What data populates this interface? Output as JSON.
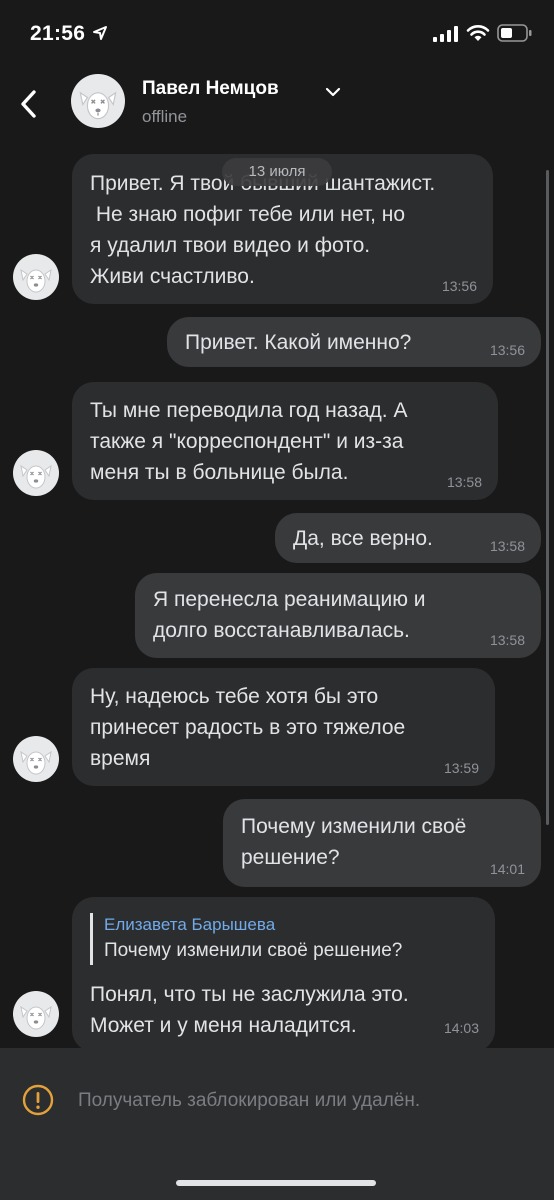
{
  "status": {
    "time": "21:56"
  },
  "header": {
    "name": "Павел Немцов",
    "presence": "offline"
  },
  "date_label": "13 июля",
  "messages": [
    {
      "dir": "in",
      "text": "Привет. Я твой бывший шантажист.\n Не знаю пофиг тебе или нет, но\nя удалил твои видео и фото.\nЖиви счастливо.",
      "time": "13:56"
    },
    {
      "dir": "out",
      "text": "Привет. Какой именно?",
      "time": "13:56"
    },
    {
      "dir": "in",
      "text": "Ты мне переводила год назад. А\nтакже я \"корреспондент\" и из-за\nменя ты в больнице была.",
      "time": "13:58"
    },
    {
      "dir": "out",
      "text": "Да, все верно.",
      "time": "13:58"
    },
    {
      "dir": "out",
      "text": "Я перенесла реанимацию и\nдолго восстанавливалась.",
      "time": "13:58"
    },
    {
      "dir": "in",
      "text": "Ну, надеюсь тебе хотя бы это\nпринесет радость в это тяжелое\nвремя",
      "time": "13:59"
    },
    {
      "dir": "out",
      "text": "Почему изменили своё\nрешение?",
      "time": "14:01"
    },
    {
      "dir": "in",
      "reply": {
        "name": "Елизавета Барышева",
        "text": "Почему изменили своё решение?"
      },
      "text": "Понял, что ты не заслужила это.\nМожет и у меня наладится.",
      "time": "14:03"
    }
  ],
  "footer": {
    "notice": "Получатель заблокирован или удалён."
  },
  "colors": {
    "background": "#191919",
    "incoming_bubble": "#2c2d2e",
    "outgoing_bubble": "#393a3c",
    "reply_name": "#71aaeb",
    "warning": "#e3a13b"
  },
  "icons": [
    "location-arrow-icon",
    "signal-icon",
    "wifi-icon",
    "battery-icon",
    "back-icon",
    "chevron-down-icon",
    "dog-avatar-icon",
    "warning-icon"
  ]
}
